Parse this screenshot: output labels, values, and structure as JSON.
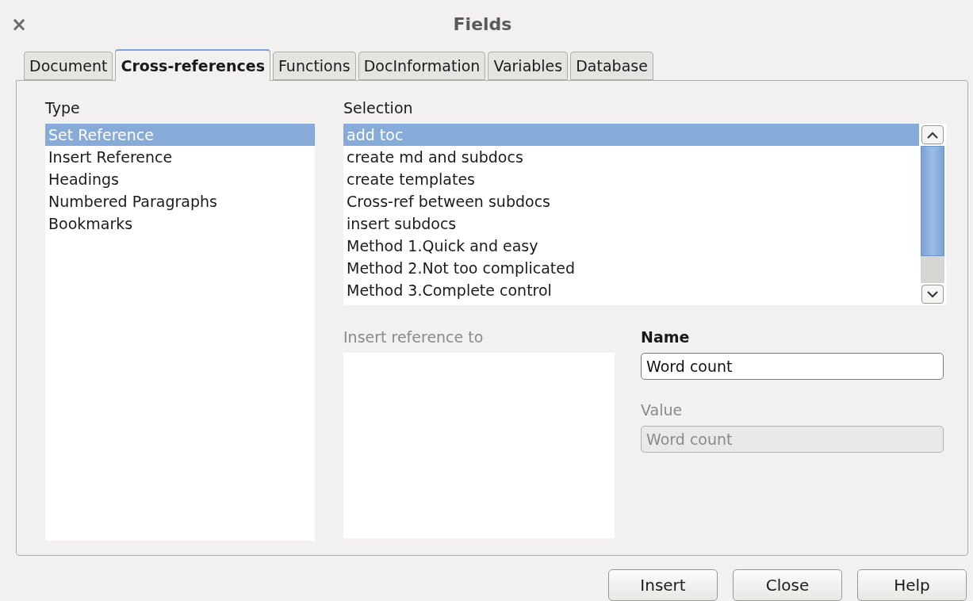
{
  "window": {
    "close": "×",
    "title": "Fields"
  },
  "tabs": [
    {
      "label": "Document",
      "selected": false
    },
    {
      "label": "Cross-references",
      "selected": true
    },
    {
      "label": "Functions",
      "selected": false
    },
    {
      "label": "DocInformation",
      "selected": false
    },
    {
      "label": "Variables",
      "selected": false
    },
    {
      "label": "Database",
      "selected": false
    }
  ],
  "type": {
    "label": "Type",
    "items": [
      {
        "label": "Set Reference",
        "selected": true
      },
      {
        "label": "Insert Reference",
        "selected": false
      },
      {
        "label": "Headings",
        "selected": false
      },
      {
        "label": "Numbered Paragraphs",
        "selected": false
      },
      {
        "label": "Bookmarks",
        "selected": false
      }
    ]
  },
  "selection": {
    "label": "Selection",
    "items": [
      {
        "label": "add toc",
        "selected": true
      },
      {
        "label": "create md and subdocs",
        "selected": false
      },
      {
        "label": "create templates",
        "selected": false
      },
      {
        "label": "Cross-ref between subdocs",
        "selected": false
      },
      {
        "label": "insert subdocs",
        "selected": false
      },
      {
        "label": "Method 1.Quick and easy",
        "selected": false
      },
      {
        "label": "Method 2.Not too complicated",
        "selected": false
      },
      {
        "label": "Method 3.Complete control",
        "selected": false
      }
    ]
  },
  "insert_reference_to": {
    "label": "Insert reference to",
    "disabled": true
  },
  "name": {
    "label": "Name",
    "value": "Word count",
    "disabled": false
  },
  "value": {
    "label": "Value",
    "value": "Word count",
    "disabled": true
  },
  "buttons": [
    "Insert",
    "Close",
    "Help"
  ]
}
